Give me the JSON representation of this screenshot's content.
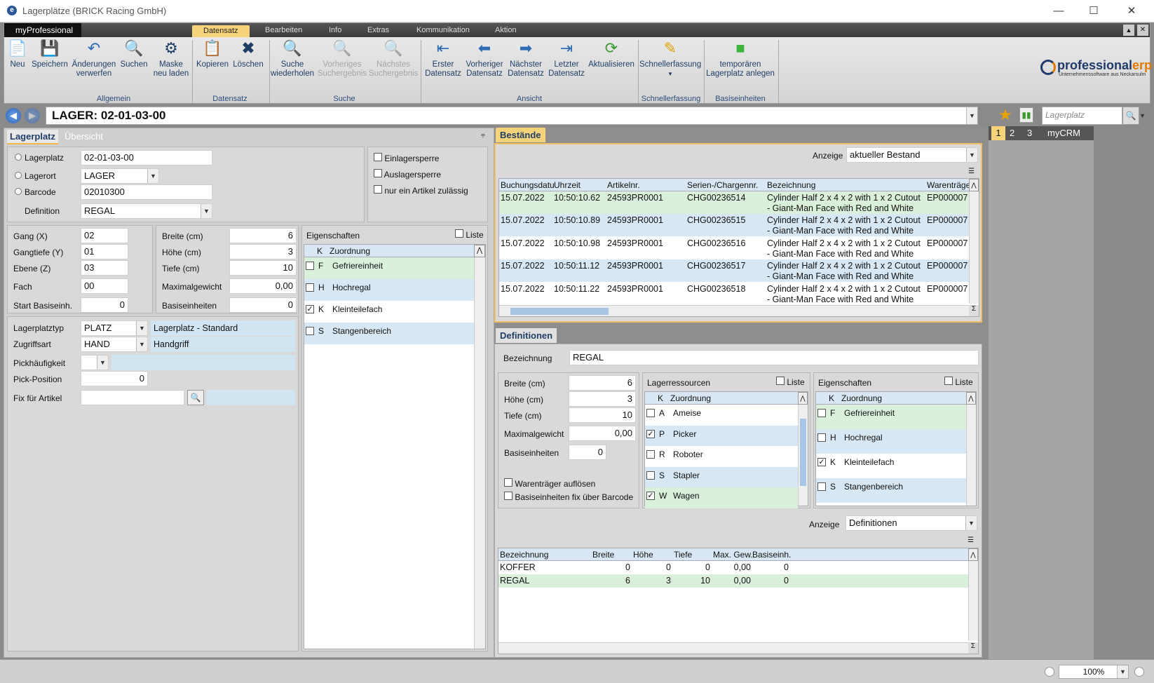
{
  "window": {
    "title": "Lagerplätze (BRICK Racing GmbH)",
    "min": "—",
    "max": "☐",
    "close": "✕"
  },
  "ribbon": {
    "app_menu": "myProfessional",
    "tabs": [
      "Datensatz",
      "Bearbeiten",
      "Info",
      "Extras",
      "Kommunikation",
      "Aktion"
    ],
    "buttons": {
      "neu": "Neu",
      "speichern": "Speichern",
      "aend": "Änderungen verwerfen",
      "suchen": "Suchen",
      "maske": "Maske neu laden",
      "kopieren": "Kopieren",
      "loeschen": "Löschen",
      "suche_wdh": "Suche wiederholen",
      "vorh": "Vorheriges Suchergebnis",
      "naechst": "Nächstes Suchergebnis",
      "erster": "Erster Datensatz",
      "vorheriger": "Vorheriger Datensatz",
      "naechster": "Nächster Datensatz",
      "letzter": "Letzter Datensatz",
      "aktual": "Aktualisieren",
      "schnell": "Schnellerfassung",
      "temp": "temporären Lagerplatz anlegen"
    },
    "groups": {
      "allgemein": "Allgemein",
      "datensatz": "Datensatz",
      "suche": "Suche",
      "ansicht": "Ansicht",
      "schnell": "Schnellerfassung",
      "basis": "Basiseinheiten"
    },
    "logo": "professional",
    "logo2": "erp",
    "logo_sub": "Unternehmenssoftware aus Neckarsulm"
  },
  "address": "LAGER: 02-01-03-00",
  "search_placeholder": "Lagerplatz",
  "right_tabs": [
    "1",
    "2",
    "3",
    "myCRM"
  ],
  "left": {
    "tabs": [
      "Lagerplatz",
      "Übersicht"
    ],
    "lagerplatz": {
      "l": "Lagerplatz",
      "v": "02-01-03-00"
    },
    "lagerort": {
      "l": "Lagerort",
      "v": "LAGER"
    },
    "barcode": {
      "l": "Barcode",
      "v": "02010300"
    },
    "definition": {
      "l": "Definition",
      "v": "REGAL"
    },
    "checks": [
      "Einlagersperre",
      "Auslagersperre",
      "nur ein Artikel zulässig"
    ],
    "dims_l": [
      {
        "l": "Gang (X)",
        "v": "02"
      },
      {
        "l": "Gangtiefe (Y)",
        "v": "01"
      },
      {
        "l": "Ebene (Z)",
        "v": "03"
      },
      {
        "l": "Fach",
        "v": "00"
      },
      {
        "l": "Start Basiseinh.",
        "v": "0"
      }
    ],
    "dims_r": [
      {
        "l": "Breite (cm)",
        "v": "6"
      },
      {
        "l": "Höhe (cm)",
        "v": "3"
      },
      {
        "l": "Tiefe (cm)",
        "v": "10"
      },
      {
        "l": "Maximalgewicht",
        "v": "0,00"
      },
      {
        "l": "Basiseinheiten",
        "v": "0"
      }
    ],
    "typ": {
      "l": "Lagerplatztyp",
      "v": "PLATZ",
      "d": "Lagerplatz - Standard"
    },
    "zugriff": {
      "l": "Zugriffsart",
      "v": "HAND",
      "d": "Handgriff"
    },
    "pick": {
      "l": "Pickhäufigkeit"
    },
    "pickpos": {
      "l": "Pick-Position",
      "v": "0"
    },
    "fix": {
      "l": "Fix für Artikel"
    },
    "eig": {
      "title": "Eigenschaften",
      "liste": "Liste",
      "h1": "K",
      "h2": "Zuordnung",
      "rows": [
        {
          "k": "F",
          "z": "Gefriereinheit",
          "c": ""
        },
        {
          "k": "H",
          "z": "Hochregal",
          "c": ""
        },
        {
          "k": "K",
          "z": "Kleinteilefach",
          "c": "✓"
        },
        {
          "k": "S",
          "z": "Stangenbereich",
          "c": ""
        }
      ]
    }
  },
  "bestaende": {
    "tab": "Bestände",
    "anzeige_l": "Anzeige",
    "anzeige_v": "aktueller Bestand",
    "headers": [
      "Buchungsdatu",
      "Uhrzeit",
      "Artikelnr.",
      "Serien-/Chargennr.",
      "Bezeichnung",
      "Warenträge"
    ],
    "rows": [
      {
        "d": "15.07.2022",
        "t": "10:50:10.62",
        "a": "24593PR0001",
        "s": "CHG00236514",
        "b1": "Cylinder Half 2 x 4 x 2 with 1 x 2 Cutout",
        "b2": "- Giant-Man Face with Red and White",
        "w": "EP000007"
      },
      {
        "d": "15.07.2022",
        "t": "10:50:10.89",
        "a": "24593PR0001",
        "s": "CHG00236515",
        "b1": "Cylinder Half 2 x 4 x 2 with 1 x 2 Cutout",
        "b2": "- Giant-Man Face with Red and White",
        "w": "EP000007"
      },
      {
        "d": "15.07.2022",
        "t": "10:50:10.98",
        "a": "24593PR0001",
        "s": "CHG00236516",
        "b1": "Cylinder Half 2 x 4 x 2 with 1 x 2 Cutout",
        "b2": "- Giant-Man Face with Red and White",
        "w": "EP000007"
      },
      {
        "d": "15.07.2022",
        "t": "10:50:11.12",
        "a": "24593PR0001",
        "s": "CHG00236517",
        "b1": "Cylinder Half 2 x 4 x 2 with 1 x 2 Cutout",
        "b2": "- Giant-Man Face with Red and White",
        "w": "EP000007"
      },
      {
        "d": "15.07.2022",
        "t": "10:50:11.22",
        "a": "24593PR0001",
        "s": "CHG00236518",
        "b1": "Cylinder Half 2 x 4 x 2 with 1 x 2 Cutout",
        "b2": "- Giant-Man Face with Red and White",
        "w": "EP000007"
      }
    ]
  },
  "defs": {
    "tab": "Definitionen",
    "bez_l": "Bezeichnung",
    "bez_v": "REGAL",
    "dims": [
      {
        "l": "Breite (cm)",
        "v": "6"
      },
      {
        "l": "Höhe (cm)",
        "v": "3"
      },
      {
        "l": "Tiefe (cm)",
        "v": "10"
      },
      {
        "l": "Maximalgewicht",
        "v": "0,00"
      },
      {
        "l": "Basiseinheiten",
        "v": "0"
      }
    ],
    "checks": [
      "Warenträger auflösen",
      "Basiseinheiten fix über Barcode"
    ],
    "res": {
      "title": "Lagerressourcen",
      "liste": "Liste",
      "h1": "K",
      "h2": "Zuordnung",
      "rows": [
        {
          "k": "A",
          "z": "Ameise",
          "c": ""
        },
        {
          "k": "P",
          "z": "Picker",
          "c": "✓"
        },
        {
          "k": "R",
          "z": "Roboter",
          "c": ""
        },
        {
          "k": "S",
          "z": "Stapler",
          "c": ""
        },
        {
          "k": "W",
          "z": "Wagen",
          "c": "✓"
        }
      ]
    },
    "eig": {
      "title": "Eigenschaften",
      "liste": "Liste",
      "h1": "K",
      "h2": "Zuordnung",
      "rows": [
        {
          "k": "F",
          "z": "Gefriereinheit",
          "c": ""
        },
        {
          "k": "H",
          "z": "Hochregal",
          "c": ""
        },
        {
          "k": "K",
          "z": "Kleinteilefach",
          "c": "✓"
        },
        {
          "k": "S",
          "z": "Stangenbereich",
          "c": ""
        }
      ]
    },
    "anzeige_l": "Anzeige",
    "anzeige_v": "Definitionen",
    "headers": [
      "Bezeichnung",
      "Breite",
      "Höhe",
      "Tiefe",
      "Max. Gew.",
      "Basiseinh."
    ],
    "rows": [
      {
        "b": "KOFFER",
        "br": "0",
        "h": "0",
        "t": "0",
        "m": "0,00",
        "be": "0"
      },
      {
        "b": "REGAL",
        "br": "6",
        "h": "3",
        "t": "10",
        "m": "0,00",
        "be": "0"
      }
    ]
  },
  "status": {
    "zoom": "100%"
  }
}
